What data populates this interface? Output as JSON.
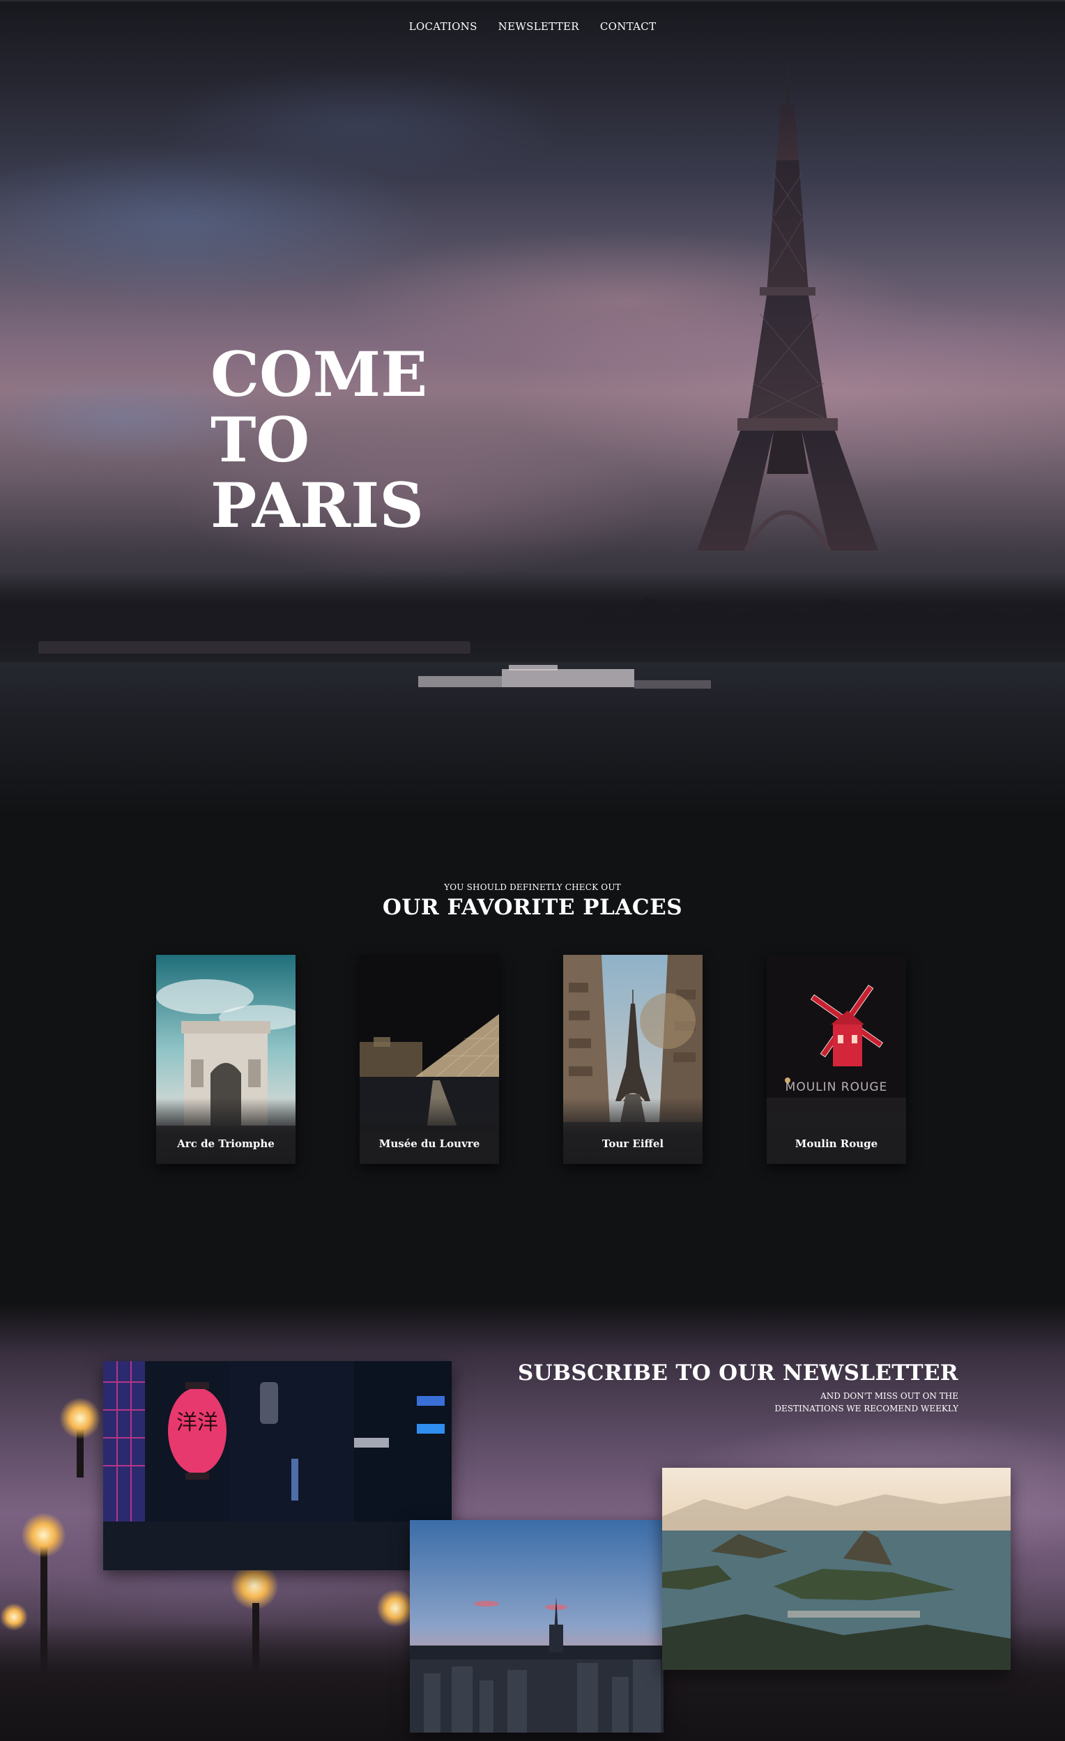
{
  "nav": {
    "items": [
      "LOCATIONS",
      "NEWSLETTER",
      "CONTACT"
    ]
  },
  "hero": {
    "title_lines": [
      "COME",
      "TO",
      "PARIS"
    ]
  },
  "favorites": {
    "kicker": "YOU SHOULD DEFINETLY CHECK OUT",
    "heading": "OUR FAVORITE PLACES",
    "cards": [
      {
        "label": "Arc de Triomphe"
      },
      {
        "label": "Musée du Louvre"
      },
      {
        "label": "Tour Eiffel"
      },
      {
        "label": "Moulin Rouge",
        "sign_text": "MOULIN ROUGE"
      }
    ]
  },
  "newsletter": {
    "heading": "SUBSCRIBE TO OUR NEWSLETTER",
    "sub_line1": "AND DON'T MISS OUT ON THE",
    "sub_line2": "DESTINATIONS WE RECOMEND WEEKLY",
    "lantern_text": "洋洋"
  },
  "colors": {
    "background": "#111214",
    "text": "#ffffff",
    "hero_sky": "#806a7e",
    "moulin_red": "#d3263a"
  }
}
